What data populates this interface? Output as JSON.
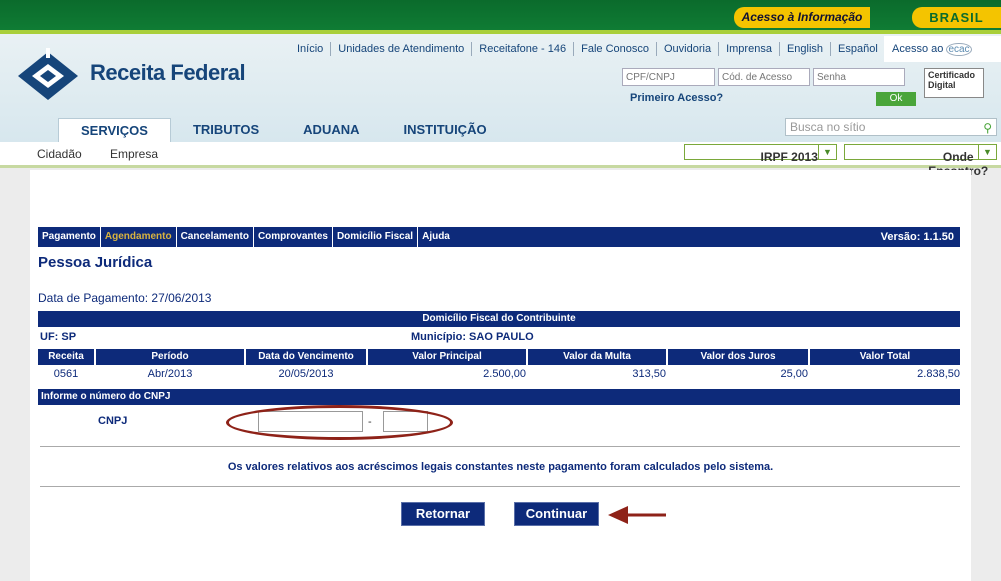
{
  "gov": {
    "acesso_informacao": "Acesso à Informação",
    "brasil": "BRASIL"
  },
  "header": {
    "logo_text": "Receita Federal",
    "top_links": [
      "Início",
      "Unidades de Atendimento",
      "Receitafone - 146",
      "Fale Conosco",
      "Ouvidoria",
      "Imprensa",
      "English",
      "Español"
    ],
    "acesso_ao": "Acesso ao",
    "ecac": "ecac",
    "login_placeholders": {
      "cpf": "CPF/CNPJ",
      "codigo": "Cód. de Acesso",
      "senha": "Senha"
    },
    "primeiro_acesso": "Primeiro Acesso?",
    "ok_label": "Ok",
    "certificado": "Certificado Digital",
    "tabs": [
      "SERVIÇOS",
      "TRIBUTOS",
      "ADUANA",
      "INSTITUIÇÃO"
    ],
    "busca_placeholder": "Busca no sítio"
  },
  "subnav": {
    "cidadao": "Cidadão",
    "empresa": "Empresa",
    "irpf": "IRPF 2013",
    "onde": "Onde Encontro?"
  },
  "menu": {
    "items": [
      "Pagamento",
      "Agendamento",
      "Cancelamento",
      "Comprovantes",
      "Domicílio Fiscal",
      "Ajuda"
    ],
    "versao": "Versão: 1.1.50"
  },
  "page": {
    "title": "Pessoa Jurídica",
    "data_pagamento": "Data de Pagamento: 27/06/2013",
    "domicilio_title": "Domicílio Fiscal do Contribuinte",
    "uf": "UF: SP",
    "municipio": "Município: SAO PAULO",
    "table_headers": [
      "Receita",
      "Período",
      "Data do Vencimento",
      "Valor Principal",
      "Valor da Multa",
      "Valor dos Juros",
      "Valor Total"
    ],
    "table_row": [
      "0561",
      "Abr/2013",
      "20/05/2013",
      "2.500,00",
      "313,50",
      "25,00",
      "2.838,50"
    ],
    "informe_cnpj": "Informe o número do CNPJ",
    "cnpj_label": "CNPJ",
    "cnpj_dash": "-",
    "note": "Os valores relativos aos acréscimos legais constantes neste pagamento foram calculados pelo sistema.",
    "retornar": "Retornar",
    "continuar": "Continuar"
  },
  "colors": {
    "navy": "#0d2a7a",
    "gov_green": "#0b6b2c",
    "yellow": "#f4c400",
    "annotation_red": "#8e2218"
  }
}
